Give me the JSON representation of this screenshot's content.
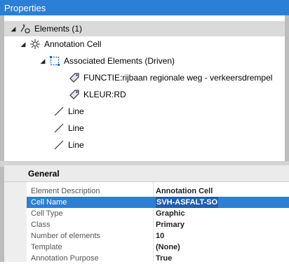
{
  "window": {
    "title": "Properties"
  },
  "tree": {
    "root": {
      "label": "Elements (1)"
    },
    "annotation_cell": {
      "label": "Annotation Cell"
    },
    "associated": {
      "label": "Associated Elements (Driven)"
    },
    "items": [
      {
        "label": "FUNCTIE:rijbaan regionale weg - verkeersdrempel"
      },
      {
        "label": "KLEUR:RD"
      }
    ],
    "lines": [
      {
        "label": "Line"
      },
      {
        "label": "Line"
      },
      {
        "label": "Line"
      }
    ]
  },
  "properties": {
    "group_title": "General",
    "rows": [
      {
        "name": "Element Description",
        "value": "Annotation Cell"
      },
      {
        "name": "Cell Name",
        "value": "SVH-ASFALT-SO"
      },
      {
        "name": "Cell Type",
        "value": "Graphic"
      },
      {
        "name": "Class",
        "value": "Primary"
      },
      {
        "name": "Number of elements",
        "value": "10"
      },
      {
        "name": "Template",
        "value": "(None)"
      },
      {
        "name": "Annotation Purpose",
        "value": "True"
      }
    ]
  },
  "colors": {
    "title_bar": "#2b7fd6",
    "selection": "#2b7fd6"
  },
  "icons": [
    "elements-icon",
    "annotation-cell-icon",
    "associated-elements-icon",
    "tag-icon",
    "line-icon",
    "expand-triangle-icon"
  ]
}
